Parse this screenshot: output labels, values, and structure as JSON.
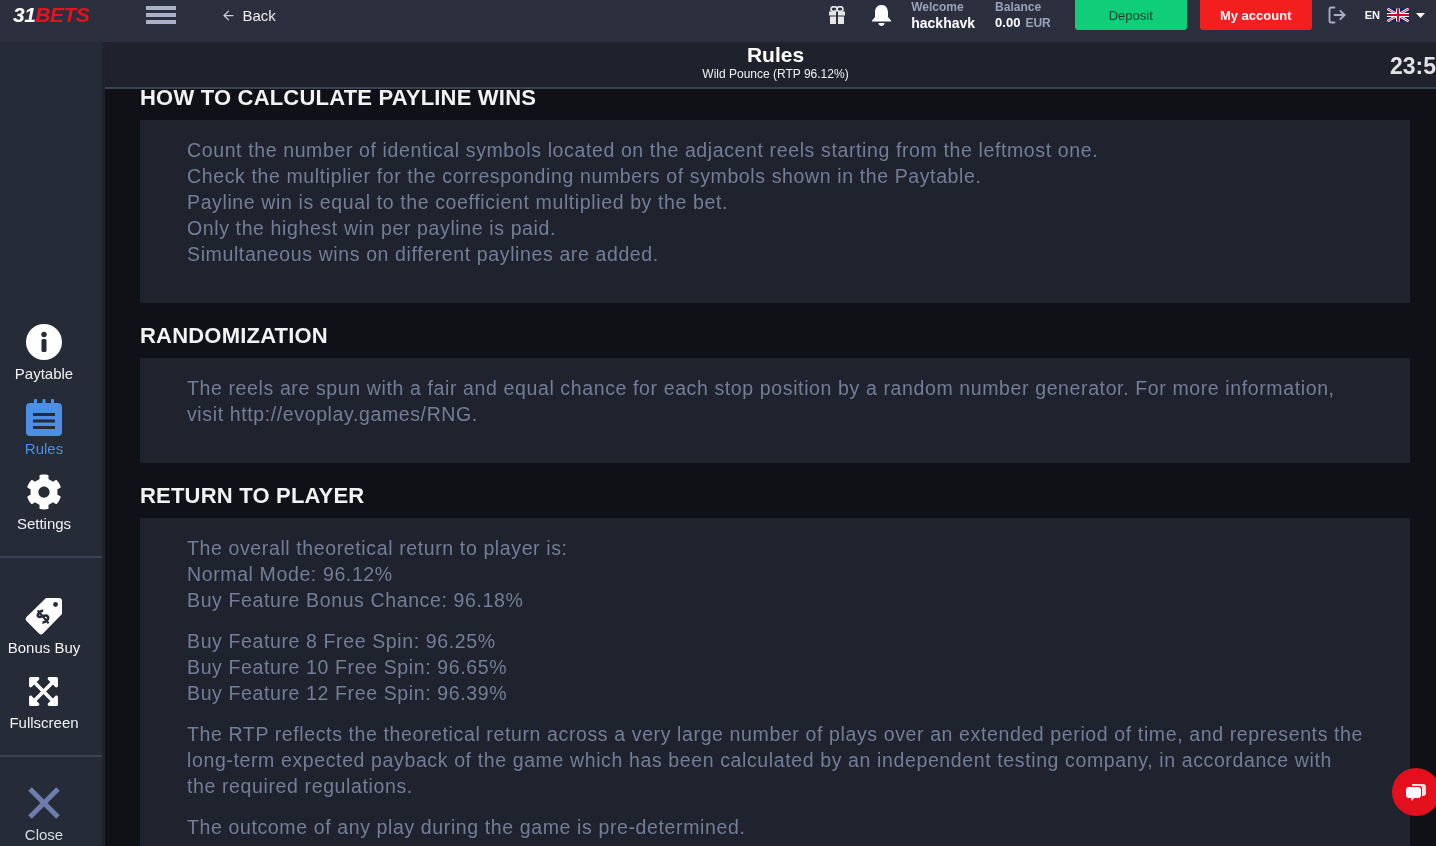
{
  "top_bar": {
    "logo": {
      "lead": "31",
      "rest": "BETS"
    },
    "back_link": "Back",
    "welcome": {
      "label": "Welcome",
      "value": "hackhavk"
    },
    "balance": {
      "label": "Balance",
      "amount": "0.00",
      "currency": "EUR"
    },
    "buttons": [
      {
        "label": "Deposit",
        "kind": "deposit"
      },
      {
        "label": "My account",
        "kind": "account"
      }
    ],
    "language": "EN"
  },
  "sidebar": {
    "groups": [
      {
        "items": [
          {
            "label": "Paytable",
            "selected": false
          },
          {
            "label": "Rules",
            "selected": true
          },
          {
            "label": "Settings",
            "selected": false
          }
        ]
      },
      {
        "items": [
          {
            "label": "Bonus Buy",
            "selected": false
          },
          {
            "label": "Fullscreen",
            "selected": false
          }
        ]
      },
      {
        "items": [
          {
            "label": "Close",
            "selected": false
          }
        ]
      }
    ]
  },
  "header": {
    "title": "Rules",
    "subtitle": "Wild Pounce (RTP 96.12%)",
    "clock": "23:5"
  },
  "sections": [
    {
      "heading": "HOW TO CALCULATE PAYLINE WINS",
      "blocks": [
        {
          "lines": [
            "Count the number of identical symbols located on the adjacent reels starting from the leftmost one.",
            "Check the multiplier for the corresponding numbers of symbols shown in the Paytable.",
            "Payline win is equal to the coefficient multiplied by the bet.",
            "Only the highest win per payline is paid.",
            "Simultaneous wins on different paylines are added."
          ]
        }
      ]
    },
    {
      "heading": "RANDOMIZATION",
      "blocks": [
        {
          "lines": [
            "The reels are spun with a fair and equal chance for each stop position by a random number generator. For more information, visit http://evoplay.games/RNG."
          ]
        }
      ]
    },
    {
      "heading": "RETURN TO PLAYER",
      "blocks": [
        {
          "lines": [
            "The overall theoretical return to player is:",
            "Normal Mode: 96.12%",
            "Buy Feature Bonus Chance: 96.18%"
          ]
        },
        {
          "lines": [
            "Buy Feature 8 Free Spin: 96.25%",
            "Buy Feature 10 Free Spin: 96.65%",
            "Buy Feature 12 Free Spin: 96.39%"
          ]
        },
        {
          "lines": [
            "The RTP reflects the theoretical return across a very large number of plays over an extended period of time, and represents the long-term expected payback of the game which has been calculated by an independent testing company, in accordance with the required regulations."
          ]
        },
        {
          "lines": [
            "The outcome of any play during the game is pre-determined."
          ]
        }
      ]
    }
  ]
}
